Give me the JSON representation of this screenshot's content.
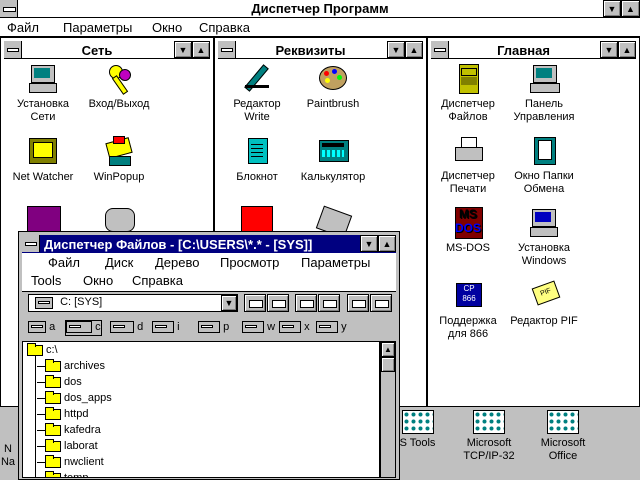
{
  "program_manager": {
    "title": "Диспетчер Программ",
    "menu": [
      "Файл",
      "Параметры",
      "Окно",
      "Справка"
    ]
  },
  "groups": [
    {
      "title": "Сеть",
      "items": [
        {
          "label1": "Установка",
          "label2": "Сети",
          "icon": "network-setup-icon"
        },
        {
          "label1": "Вход/Выход",
          "label2": "",
          "icon": "keys-icon"
        },
        {
          "label1": "Net Watcher",
          "label2": "",
          "icon": "net-watcher-icon"
        },
        {
          "label1": "WinPopup",
          "label2": "",
          "icon": "winpopup-icon"
        }
      ]
    },
    {
      "title": "Реквизиты",
      "items": [
        {
          "label1": "Редактор",
          "label2": "Write",
          "icon": "write-pen-icon"
        },
        {
          "label1": "Paintbrush",
          "label2": "",
          "icon": "paint-palette-icon"
        },
        {
          "label1": "Блокнот",
          "label2": "",
          "icon": "notepad-icon"
        },
        {
          "label1": "Калькулятор",
          "label2": "",
          "icon": "calculator-icon"
        }
      ]
    },
    {
      "title": "Главная",
      "items": [
        {
          "label1": "Диспетчер",
          "label2": "Файлов",
          "icon": "file-cabinet-icon"
        },
        {
          "label1": "Панель",
          "label2": "Управления",
          "icon": "control-panel-icon"
        },
        {
          "label1": "Диспетчер",
          "label2": "Печати",
          "icon": "printer-icon"
        },
        {
          "label1": "Окно Папки",
          "label2": "Обмена",
          "icon": "clipboard-icon"
        },
        {
          "label1": "MS-DOS",
          "label2": "",
          "icon": "msdos-icon"
        },
        {
          "label1": "Установка",
          "label2": "Windows",
          "icon": "windows-setup-icon"
        },
        {
          "label1": "Поддержка",
          "label2": "для 866",
          "icon": "cp866-icon"
        },
        {
          "label1": "Редактор PIF",
          "label2": "",
          "icon": "pif-editor-icon"
        }
      ]
    }
  ],
  "minimized_groups": [
    {
      "label1": "N",
      "label2": "Na"
    },
    {
      "label1": "",
      "label2": "S Tools"
    },
    {
      "label1": "Microsoft",
      "label2": "TCP/IP-32"
    },
    {
      "label1": "Microsoft",
      "label2": "Office"
    }
  ],
  "file_manager": {
    "title": "Диспетчер Файлов - [C:\\USERS\\*.* - [SYS]]",
    "menu_row1": [
      "Файл",
      "Диск",
      "Дерево",
      "Просмотр",
      "Параметры"
    ],
    "menu_row2": [
      "Tools",
      "Окно",
      "Справка"
    ],
    "drive_select": "C: [SYS]",
    "drives": [
      "a",
      "c",
      "d",
      "i",
      "p",
      "w",
      "x",
      "y"
    ],
    "tree": [
      "c:\\",
      "archives",
      "dos",
      "dos_apps",
      "httpd",
      "kafedra",
      "laborat",
      "nwclient",
      "temp"
    ]
  }
}
